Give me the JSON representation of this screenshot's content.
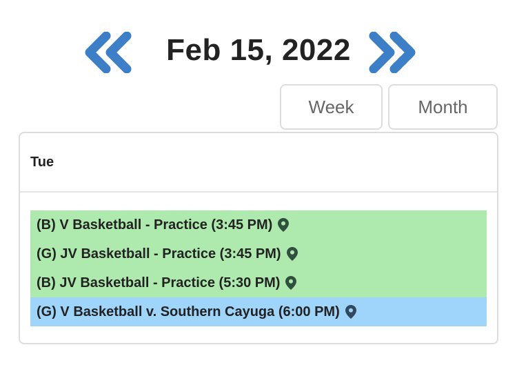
{
  "header": {
    "date": "Feb 15, 2022",
    "prev_icon": "double-chevron-left-icon",
    "next_icon": "double-chevron-right-icon",
    "icon_color": "#3d7fc6"
  },
  "views": {
    "week_label": "Week",
    "month_label": "Month"
  },
  "day": {
    "label": "Tue"
  },
  "events": [
    {
      "text": "(B) V Basketball - Practice (3:45 PM)",
      "color": "#aeeaad",
      "icon": "map-pin-icon"
    },
    {
      "text": "(G) JV Basketball - Practice (3:45 PM)",
      "color": "#aeeaad",
      "icon": "map-pin-icon"
    },
    {
      "text": "(B) JV Basketball - Practice (5:30 PM)",
      "color": "#aeeaad",
      "icon": "map-pin-icon"
    },
    {
      "text": "(G) V Basketball v. Southern Cayuga (6:00 PM)",
      "color": "#9fd4fb",
      "icon": "map-pin-icon"
    }
  ]
}
